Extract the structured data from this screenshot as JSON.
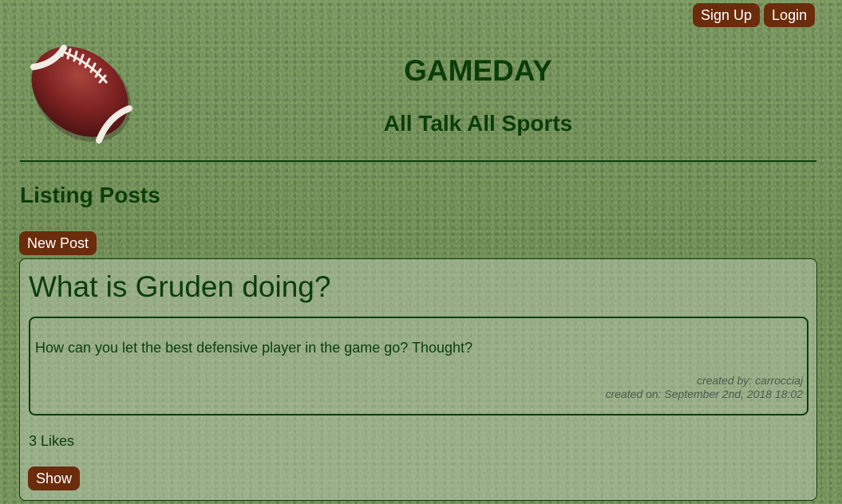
{
  "nav": {
    "signup_label": "Sign Up",
    "login_label": "Login"
  },
  "header": {
    "title": "GAMEDAY",
    "tagline": "All Talk All Sports",
    "logo_icon": "football-icon"
  },
  "main": {
    "heading": "Listing Posts",
    "new_post_label": "New Post",
    "posts": [
      {
        "title": "What is Gruden doing?",
        "body": "How can you let the best defensive player in the game go? Thought?",
        "created_by": "created by: carrocciaj",
        "created_on": "created on: September 2nd, 2018 18:02",
        "likes": "3 Likes",
        "show_label": "Show"
      }
    ]
  },
  "colors": {
    "text_green": "#0a3d0a",
    "button_brown": "#6b2c0c",
    "football_brown": "#7a2020"
  }
}
